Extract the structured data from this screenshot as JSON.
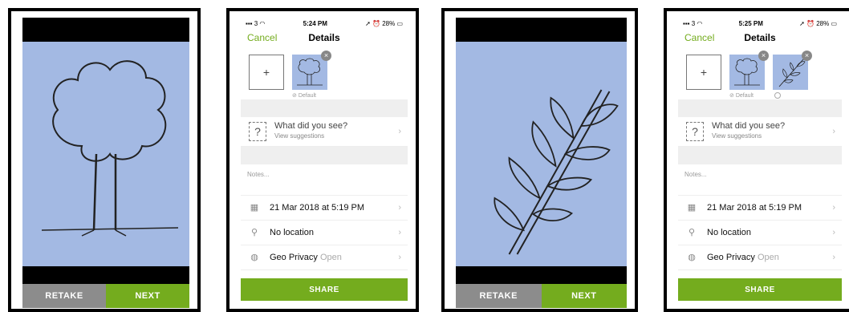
{
  "camera_screens": [
    {
      "retake_label": "RETAKE",
      "next_label": "NEXT",
      "subject": "tree drawing"
    },
    {
      "retake_label": "RETAKE",
      "next_label": "NEXT",
      "subject": "leaf branch drawing"
    }
  ],
  "details_screens": [
    {
      "status": {
        "signal": "3",
        "time": "5:24 PM",
        "battery": "28%"
      },
      "nav": {
        "cancel_label": "Cancel",
        "title": "Details"
      },
      "add_label": "+",
      "default_label": "Default",
      "species_prompt": "What did you see?",
      "species_sub": "View suggestions",
      "notes_placeholder": "Notes...",
      "date_text": "21 Mar 2018 at 5:19 PM",
      "location_text": "No location",
      "geo_privacy_label": "Geo Privacy",
      "geo_privacy_value": "Open",
      "share_label": "SHARE"
    },
    {
      "status": {
        "signal": "3",
        "time": "5:25 PM",
        "battery": "28%"
      },
      "nav": {
        "cancel_label": "Cancel",
        "title": "Details"
      },
      "add_label": "+",
      "default_label": "Default",
      "species_prompt": "What did you see?",
      "species_sub": "View suggestions",
      "notes_placeholder": "Notes...",
      "date_text": "21 Mar 2018 at 5:19 PM",
      "location_text": "No location",
      "geo_privacy_label": "Geo Privacy",
      "geo_privacy_value": "Open",
      "share_label": "SHARE"
    }
  ],
  "colors": {
    "accent_green": "#74ac1e",
    "photo_blue": "#a3b9e3",
    "retake_gray": "#8c8c8c"
  }
}
